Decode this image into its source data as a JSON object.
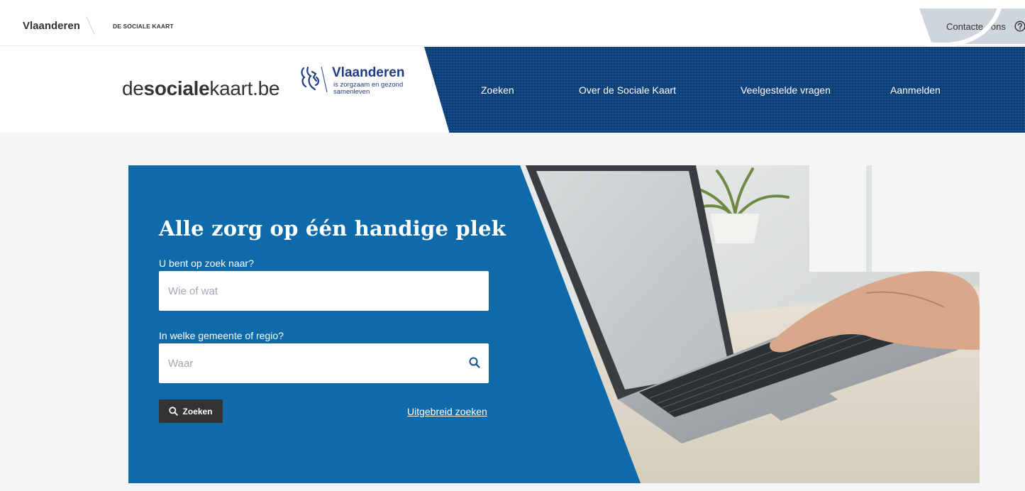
{
  "topbar": {
    "brand": "Vlaanderen",
    "app_name": "DE SOCIALE KAART",
    "contact_label": "Contacte . ons"
  },
  "header": {
    "logo_prefix": "de",
    "logo_bold": "sociale",
    "logo_suffix": "kaart.be",
    "vl_name": "Vlaanderen",
    "vl_tagline": "is zorgzaam en gezond samenleven",
    "nav": [
      "Zoeken",
      "Over de Sociale Kaart",
      "Veelgestelde vragen",
      "Aanmelden"
    ]
  },
  "hero": {
    "title": "Alle zorg op één handige plek",
    "what_label": "U bent op zoek naar?",
    "what_placeholder": "Wie of wat",
    "where_label": "In welke gemeente of regio?",
    "where_placeholder": "Waar",
    "search_button": "Zoeken",
    "advanced_link": "Uitgebreid zoeken"
  },
  "colors": {
    "nav_blue": "#0c3f78",
    "hero_blue": "#0e6aa8",
    "flanders_blue": "#1f3c88",
    "dark_button": "#333332"
  },
  "icons": {
    "help": "question-circle-icon",
    "logo": "flemish-lion-icon",
    "search": "magnifier-icon"
  }
}
